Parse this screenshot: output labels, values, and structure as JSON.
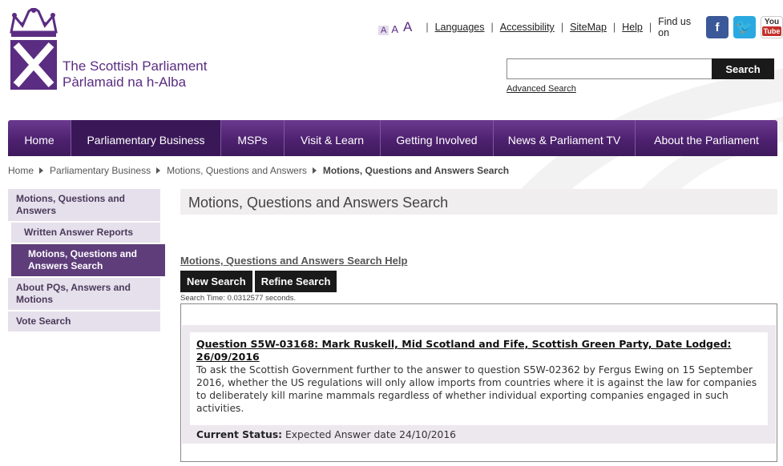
{
  "header": {
    "logo_line1": "The Scottish Parliament",
    "logo_line2": "Pàrlamaid na h-Alba",
    "text_size": [
      "A",
      "A",
      "A"
    ],
    "links": [
      "Languages",
      "Accessibility",
      "SiteMap",
      "Help"
    ],
    "find_us": "Find us on",
    "social": [
      "facebook-icon",
      "twitter-icon",
      "youtube-icon"
    ],
    "search_value": "",
    "search_button": "Search",
    "advanced_search": "Advanced Search",
    "youtube_you": "You",
    "youtube_tube": "Tube"
  },
  "nav": {
    "items": [
      "Home",
      "Parliamentary Business",
      "MSPs",
      "Visit & Learn",
      "Getting Involved",
      "News & Parliament TV",
      "About the Parliament"
    ],
    "active": "Parliamentary Business"
  },
  "breadcrumb": [
    "Home",
    "Parliamentary Business",
    "Motions, Questions and Answers",
    "Motions, Questions and Answers Search"
  ],
  "sidebar": {
    "items": [
      "Motions, Questions and Answers",
      "Written Answer Reports",
      "Motions, Questions and Answers Search",
      "About PQs, Answers and Motions",
      "Vote Search"
    ]
  },
  "main": {
    "title": "Motions, Questions and Answers Search",
    "help_link": "Motions, Questions and Answers Search Help",
    "new_search": "New Search",
    "refine_search": "Refine Search",
    "search_time": "Search Time: 0.0312577 seconds.",
    "result": {
      "title": "Question S5W-03168: Mark Ruskell, Mid Scotland and Fife, Scottish Green Party, Date Lodged: 26/09/2016",
      "text": "To ask the Scottish Government further to the answer to question S5W-02362 by Fergus Ewing on 15 September 2016, whether the US regulations will only allow imports from countries where it is against the law for companies to deliberately kill marine mammals regardless of whether individual exporting companies engaged in such activities.",
      "status_label": "Current Status:",
      "status_value": "Expected Answer date 24/10/2016"
    }
  },
  "colors": {
    "brand_purple": "#5a2d82",
    "nav_purple": "#4e2170",
    "sidebar_bg": "#e6e0ec",
    "sidebar_active": "#5e3d7a"
  }
}
